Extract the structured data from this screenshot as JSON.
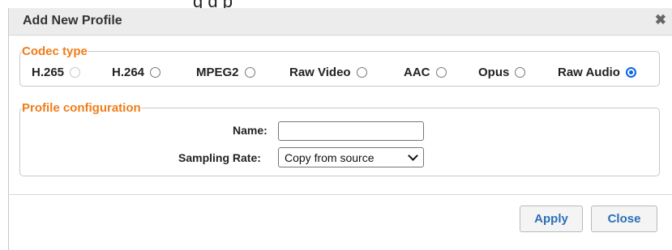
{
  "top_clip_text": "g  d   p",
  "dialog": {
    "title": "Add New Profile",
    "close_glyph": "✖"
  },
  "codec_type": {
    "legend": "Codec type",
    "options": [
      {
        "label": "H.265",
        "state": "disabled"
      },
      {
        "label": "H.264",
        "state": "unchecked"
      },
      {
        "label": "MPEG2",
        "state": "unchecked"
      },
      {
        "label": "Raw Video",
        "state": "unchecked"
      },
      {
        "label": "AAC",
        "state": "unchecked"
      },
      {
        "label": "Opus",
        "state": "unchecked"
      },
      {
        "label": "Raw Audio",
        "state": "checked"
      }
    ]
  },
  "profile_configuration": {
    "legend": "Profile configuration",
    "name_label": "Name:",
    "name_value": "",
    "sampling_rate_label": "Sampling Rate:",
    "sampling_rate_value": "Copy from source"
  },
  "buttons": {
    "apply": "Apply",
    "close": "Close"
  },
  "colors": {
    "legend_orange": "#ef7d1a",
    "button_text_blue": "#2b6fb6",
    "radio_checked_blue": "#0b63e6"
  }
}
